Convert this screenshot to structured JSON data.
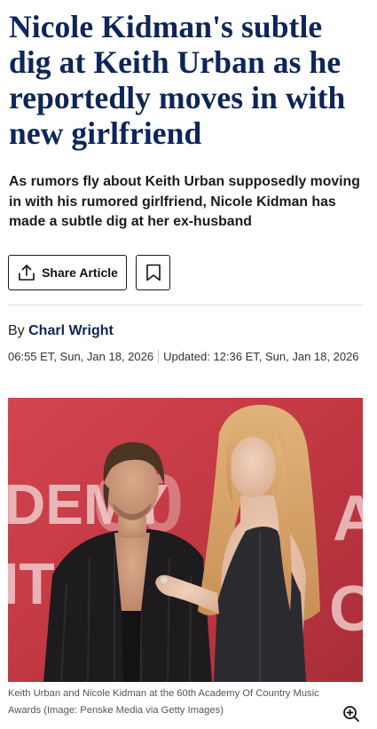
{
  "article": {
    "headline": "Nicole Kidman's subtle dig at Keith Urban as he reportedly moves in with new girlfriend",
    "standfirst": "As rumors fly about Keith Urban supposedly moving in with his rumored girlfriend, Nicole Kidman has made a subtle dig at her ex-husband"
  },
  "actions": {
    "share_label": "Share Article",
    "share_icon": "share-icon",
    "bookmark_icon": "bookmark-icon"
  },
  "byline": {
    "prefix": "By",
    "author": "Charl Wright"
  },
  "timestamps": {
    "published": "06:55 ET, Sun, Jan 18, 2026",
    "updated": "Updated: 12:36 ET, Sun, Jan 18, 2026"
  },
  "image": {
    "caption": "Keith Urban and Nicole Kidman at the 60th Academy Of Country Music Awards",
    "credit": "(Image: Penske Media via Getty Images)",
    "backdrop_text_left": "DEMY",
    "backdrop_text_left_2": "ITRI",
    "backdrop_text_right": "A",
    "backdrop_text_right_2": "CC",
    "backdrop_number": "60",
    "zoom_icon": "zoom-in-icon"
  },
  "colors": {
    "headline": "#0d2559",
    "author": "#0d2559",
    "backdrop": "#c73a45"
  }
}
